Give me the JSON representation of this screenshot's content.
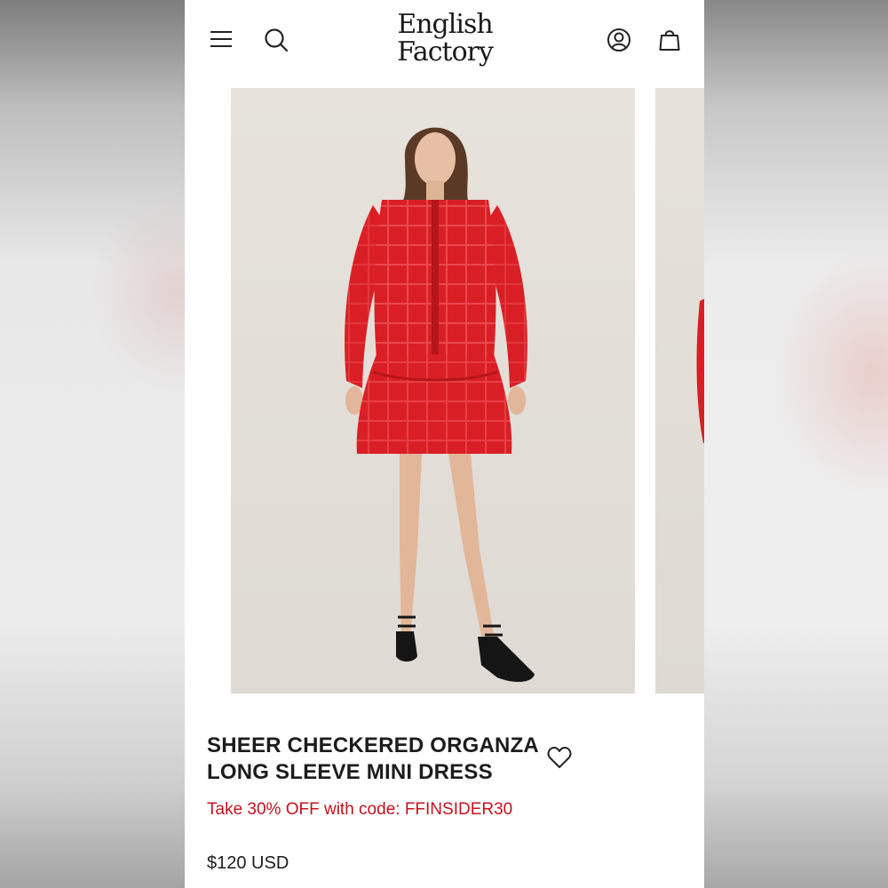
{
  "brand": {
    "logo_line1": "English",
    "logo_line2": "Factory"
  },
  "header": {
    "icons": [
      "menu-icon",
      "search-icon",
      "account-icon",
      "cart-icon"
    ]
  },
  "product": {
    "title_line1": "SHEER CHECKERED ORGANZA",
    "title_line2": "LONG SLEEVE MINI DRESS",
    "promo": "Take 30% OFF with code: FFINSIDER30",
    "price": "$120 USD",
    "wishlist_icon": "heart-outline-icon"
  },
  "colors": {
    "promo": "#c3121b",
    "dress": "#d91f25",
    "text": "#1c1c1c"
  }
}
